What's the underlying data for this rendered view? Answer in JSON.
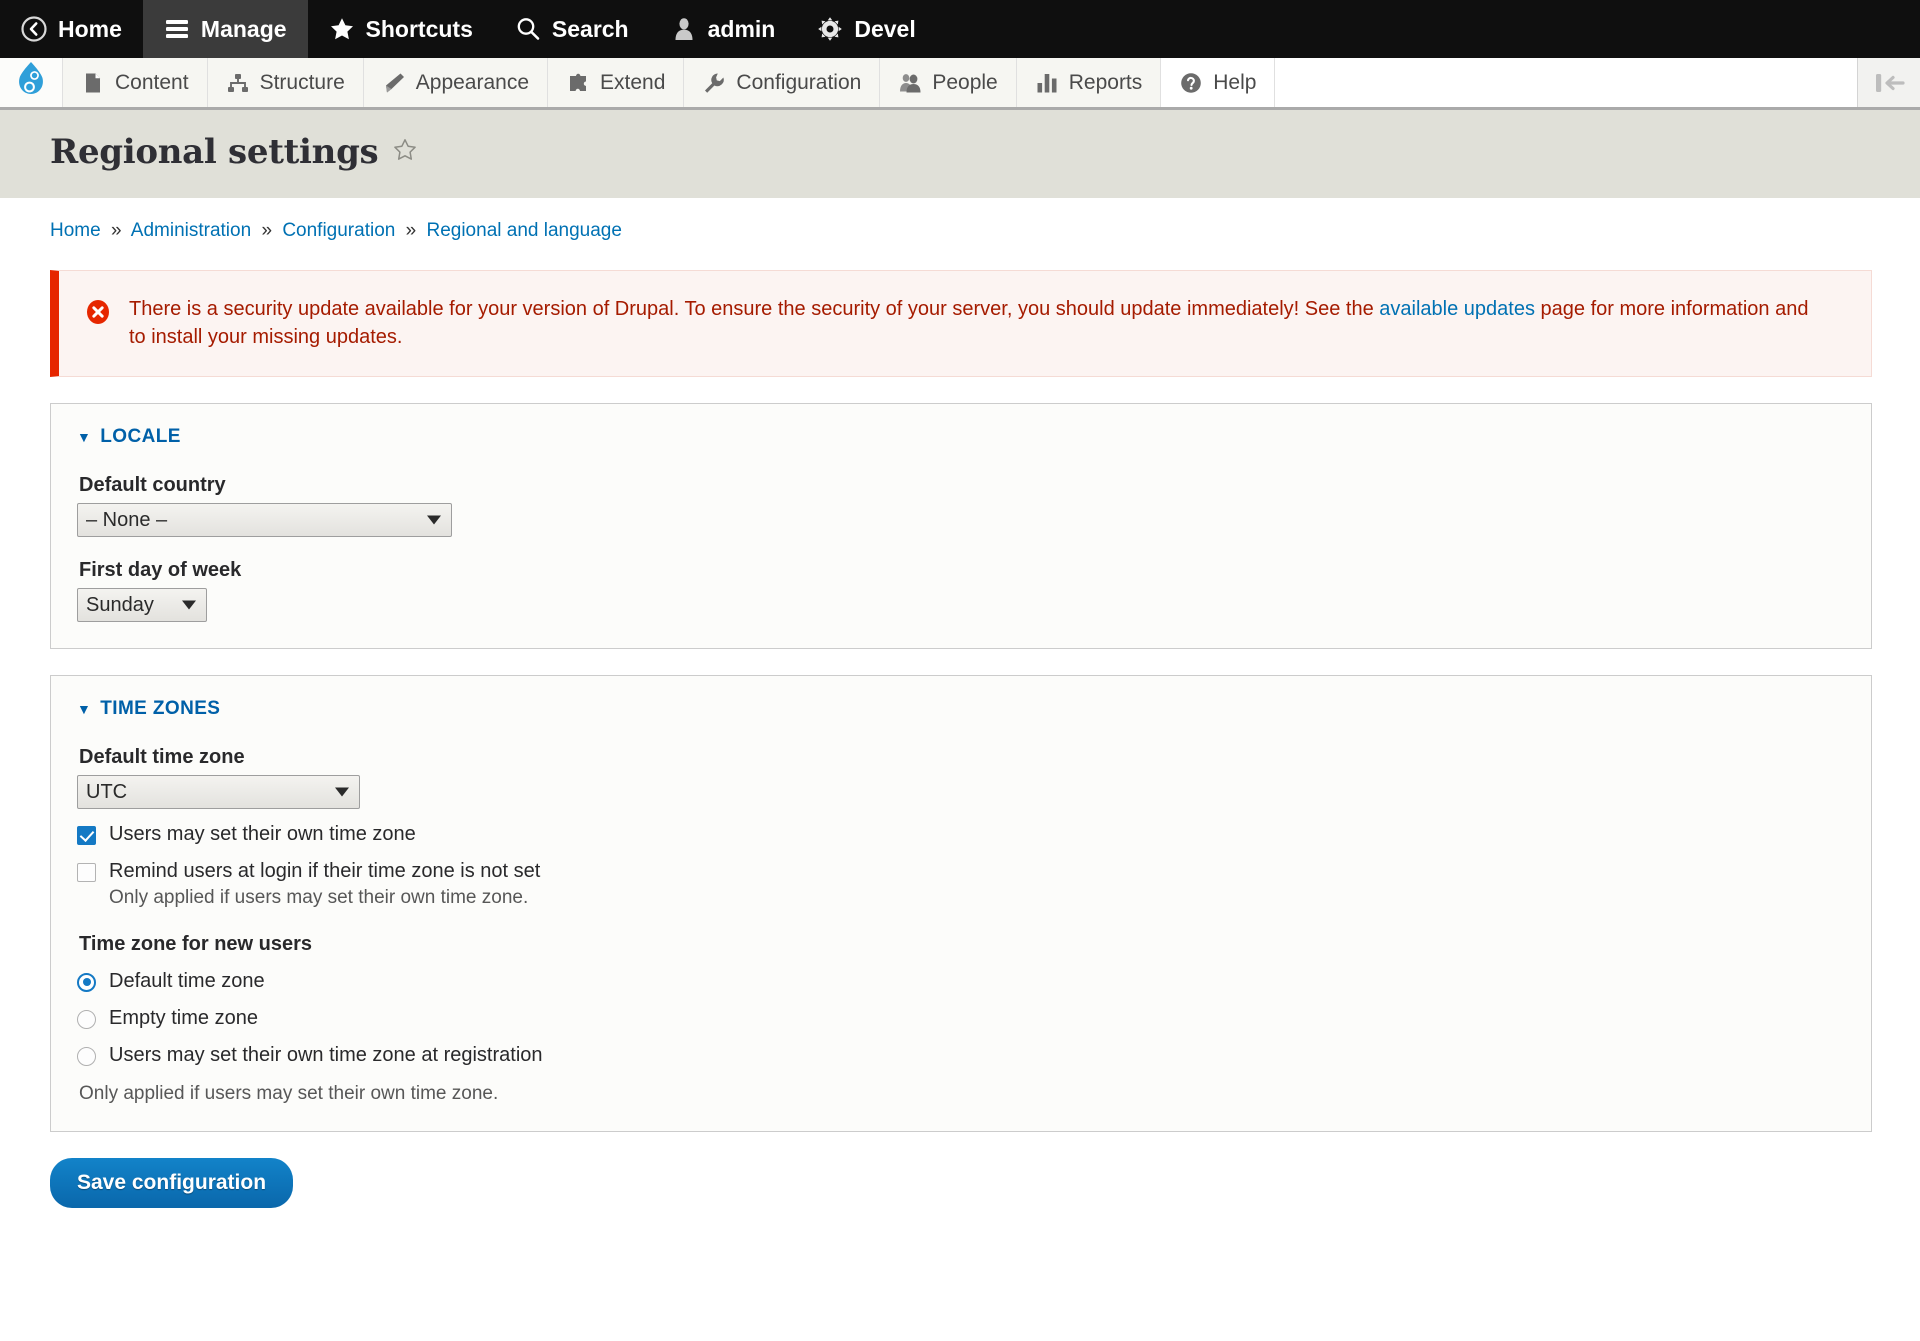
{
  "admin_bar": {
    "items": [
      {
        "label": "Home",
        "icon": "home-back-icon",
        "active": false
      },
      {
        "label": "Manage",
        "icon": "hamburger-icon",
        "active": true
      },
      {
        "label": "Shortcuts",
        "icon": "star-icon",
        "active": false
      },
      {
        "label": "Search",
        "icon": "search-icon",
        "active": false
      },
      {
        "label": "admin",
        "icon": "user-icon",
        "active": false
      },
      {
        "label": "Devel",
        "icon": "gear-icon",
        "active": false
      }
    ]
  },
  "menu_bar": {
    "logo": "drupal-drop-logo",
    "items": [
      {
        "label": "Content",
        "icon": "document-icon"
      },
      {
        "label": "Structure",
        "icon": "sitemap-icon"
      },
      {
        "label": "Appearance",
        "icon": "paintbrush-icon"
      },
      {
        "label": "Extend",
        "icon": "puzzle-piece-icon"
      },
      {
        "label": "Configuration",
        "icon": "wrench-icon"
      },
      {
        "label": "People",
        "icon": "people-icon"
      },
      {
        "label": "Reports",
        "icon": "bar-chart-icon"
      },
      {
        "label": "Help",
        "icon": "question-mark-icon"
      }
    ],
    "collapse_icon": "collapse-left-icon"
  },
  "page": {
    "title": "Regional settings",
    "favorite_icon": "star-outline-icon"
  },
  "breadcrumb": {
    "separator": "»",
    "items": [
      {
        "label": "Home"
      },
      {
        "label": "Administration"
      },
      {
        "label": "Configuration"
      },
      {
        "label": "Regional and language"
      }
    ]
  },
  "message": {
    "type": "error",
    "icon": "error-circle-icon",
    "text_before": "There is a security update available for your version of Drupal. To ensure the security of your server, you should update immediately! See the ",
    "link_text": "available updates",
    "text_after": " page for more information and to install your missing updates.",
    "accent_color": "#e62600",
    "background_color": "#fcf4f2",
    "text_color": "#a51b00"
  },
  "locale": {
    "legend": "LOCALE",
    "collapse_icon": "triangle-down-icon",
    "default_country": {
      "label": "Default country",
      "value": "– None –",
      "options": [
        "– None –"
      ]
    },
    "first_day_of_week": {
      "label": "First day of week",
      "value": "Sunday",
      "options": [
        "Sunday"
      ]
    }
  },
  "time_zones": {
    "legend": "TIME ZONES",
    "collapse_icon": "triangle-down-icon",
    "default_time_zone": {
      "label": "Default time zone",
      "value": "UTC",
      "options": [
        "UTC"
      ]
    },
    "users_may_set": {
      "label": "Users may set their own time zone",
      "checked": true
    },
    "remind_users": {
      "label": "Remind users at login if their time zone is not set",
      "checked": false,
      "description": "Only applied if users may set their own time zone."
    },
    "new_users_group": {
      "label": "Time zone for new users",
      "options": [
        {
          "label": "Default time zone",
          "selected": true
        },
        {
          "label": "Empty time zone",
          "selected": false
        },
        {
          "label": "Users may set their own time zone at registration",
          "selected": false
        }
      ],
      "description": "Only applied if users may set their own time zone."
    }
  },
  "actions": {
    "save_label": "Save configuration",
    "accent_color": "#0f76bd"
  }
}
